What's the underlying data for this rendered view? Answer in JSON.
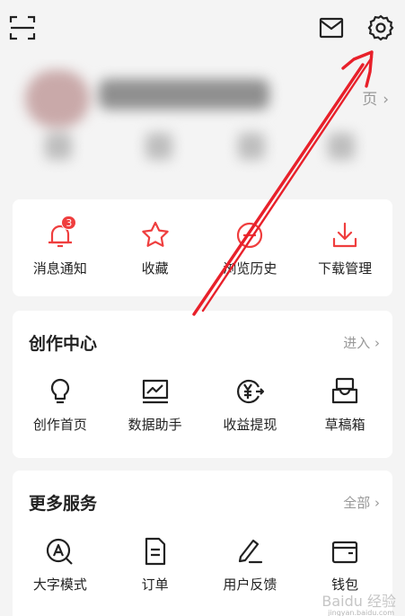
{
  "topbar": {
    "scan_icon": "scan-icon",
    "mail_icon": "mail-icon",
    "settings_icon": "gear-icon"
  },
  "profile": {
    "home_link": "页"
  },
  "quick_actions": {
    "items": [
      {
        "label": "消息通知",
        "icon": "bell-icon",
        "badge": "3"
      },
      {
        "label": "收藏",
        "icon": "star-icon"
      },
      {
        "label": "浏览历史",
        "icon": "clock-icon"
      },
      {
        "label": "下载管理",
        "icon": "download-icon"
      }
    ]
  },
  "creation_center": {
    "title": "创作中心",
    "more_label": "进入",
    "items": [
      {
        "label": "创作首页",
        "icon": "lightbulb-icon"
      },
      {
        "label": "数据助手",
        "icon": "chart-icon"
      },
      {
        "label": "收益提现",
        "icon": "yen-icon"
      },
      {
        "label": "草稿箱",
        "icon": "draft-box-icon"
      }
    ]
  },
  "more_services": {
    "title": "更多服务",
    "more_label": "全部",
    "items": [
      {
        "label": "大字模式",
        "icon": "large-font-icon"
      },
      {
        "label": "订单",
        "icon": "order-icon"
      },
      {
        "label": "用户反馈",
        "icon": "feedback-icon"
      },
      {
        "label": "钱包",
        "icon": "wallet-icon"
      }
    ]
  },
  "watermark": {
    "text": "Baidu 经验",
    "sub": "jingyan.baidu.com"
  },
  "colors": {
    "accent_red": "#ef3e3e",
    "annotation_arrow": "#e8202a"
  }
}
